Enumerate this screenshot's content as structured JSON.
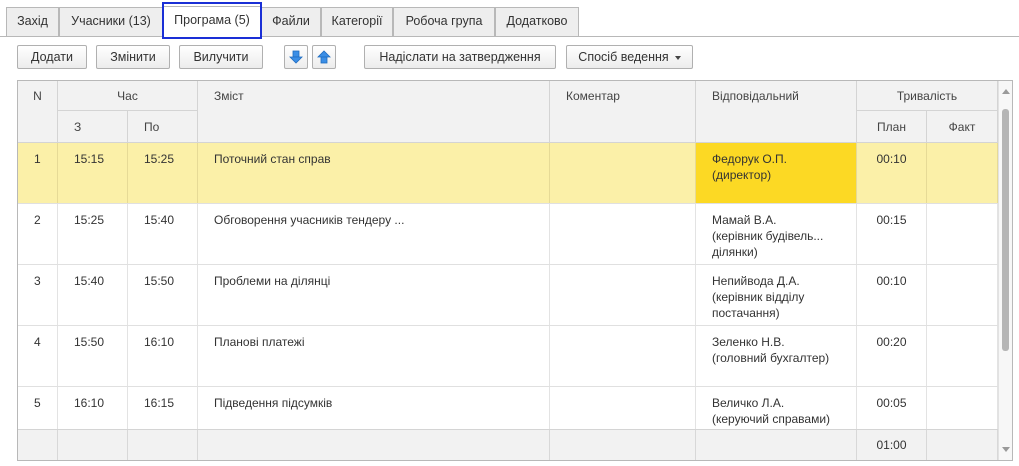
{
  "tabs": [
    {
      "label": "Захід"
    },
    {
      "label": "Учасники (13)"
    },
    {
      "label": "Програма (5)"
    },
    {
      "label": "Файли"
    },
    {
      "label": "Категорії"
    },
    {
      "label": "Робоча група"
    },
    {
      "label": "Додатково"
    }
  ],
  "active_tab": "Програма (5)",
  "toolbar": {
    "add": "Додати",
    "edit": "Змінити",
    "delete": "Вилучити",
    "move_down_icon": "arrow-down-icon",
    "move_up_icon": "arrow-up-icon",
    "send_approval": "Надіслати на затвердження",
    "mode": "Спосіб ведення"
  },
  "table": {
    "headers": {
      "n": "N",
      "time": "Час",
      "from": "З",
      "to": "По",
      "content": "Зміст",
      "comment": "Коментар",
      "responsible": "Відповідальний",
      "duration": "Тривалість",
      "plan": "План",
      "fact": "Факт"
    },
    "rows": [
      {
        "n": "1",
        "from": "15:15",
        "to": "15:25",
        "content": "Поточний стан справ",
        "comment": "",
        "resp1": "Федорук О.П.",
        "resp2": "(директор)",
        "resp3": "",
        "plan": "00:10",
        "fact": "",
        "selected": true
      },
      {
        "n": "2",
        "from": "15:25",
        "to": "15:40",
        "content": "Обговорення учасників тендеру ...",
        "comment": "",
        "resp1": "Мамай В.А.",
        "resp2": "(керівник будівель...",
        "resp3": "ділянки)",
        "plan": "00:15",
        "fact": ""
      },
      {
        "n": "3",
        "from": "15:40",
        "to": "15:50",
        "content": "Проблеми на ділянці",
        "comment": "",
        "resp1": "Непийвода Д.А.",
        "resp2": "(керівник відділу",
        "resp3": "постачання)",
        "plan": "00:10",
        "fact": ""
      },
      {
        "n": "4",
        "from": "15:50",
        "to": "16:10",
        "content": "Планові платежі",
        "comment": "",
        "resp1": "Зеленко Н.В.",
        "resp2": "(головний бухгалтер)",
        "resp3": "",
        "plan": "00:20",
        "fact": ""
      },
      {
        "n": "5",
        "from": "16:10",
        "to": "16:15",
        "content": "Підведення підсумків",
        "comment": "",
        "resp1": "Величко Л.А.",
        "resp2": "(керуючий справами)",
        "resp3": "",
        "plan": "00:05",
        "fact": ""
      }
    ],
    "total_plan": "01:00"
  },
  "colors": {
    "selected_row": "#fbf0a8",
    "current_cell": "#fcd924",
    "tab_highlight": "#1a2fd6",
    "arrow_blue": "#3a8ee6"
  }
}
